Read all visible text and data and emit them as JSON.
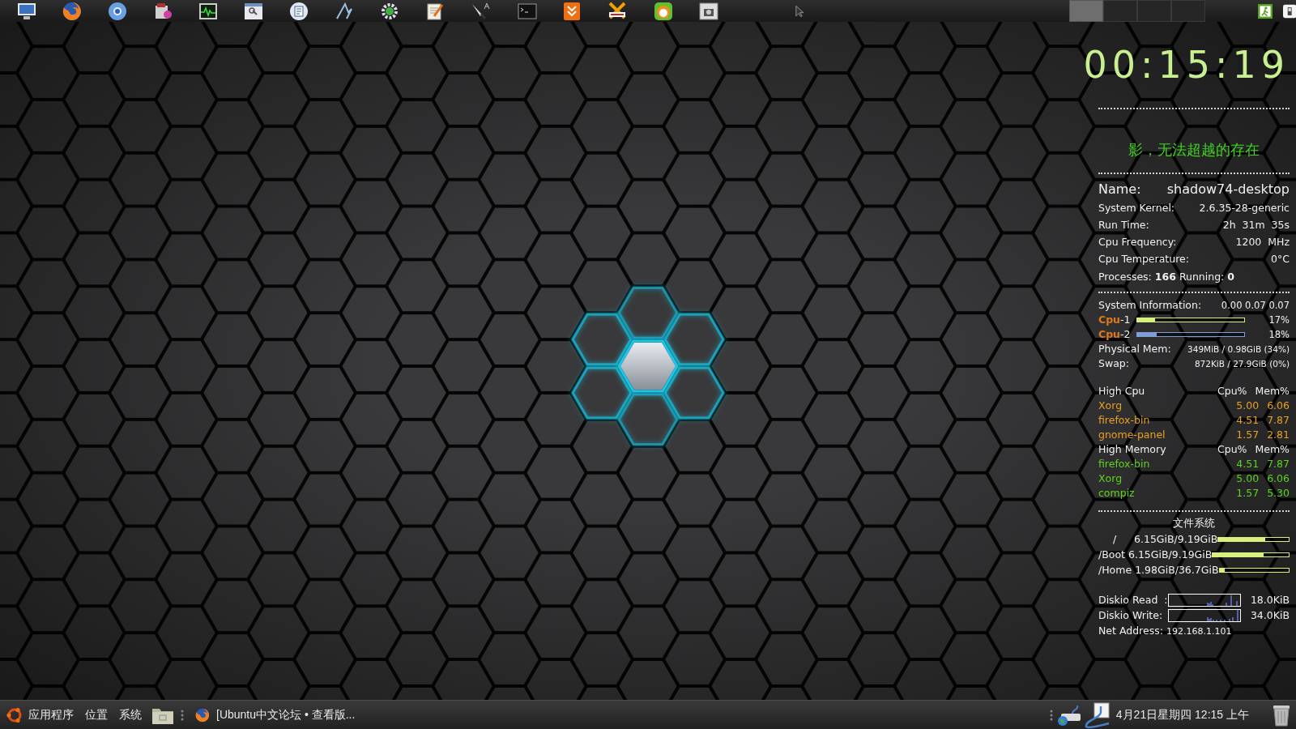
{
  "top_panel": {
    "workspaces": [
      {
        "selected": true
      },
      {
        "selected": false
      },
      {
        "selected": false
      },
      {
        "selected": false
      }
    ]
  },
  "conky": {
    "clock": "00:15:19",
    "motto": "影，无法超越的存在",
    "name": {
      "label": "Name:",
      "value": "shadow74-desktop"
    },
    "info": [
      {
        "label": "System Kernel:",
        "value": "2.6.35-28-generic"
      },
      {
        "label": "Run Time:",
        "value": "2h  31m  35s"
      },
      {
        "label": "Cpu Frequency:",
        "value": "1200  MHz"
      },
      {
        "label": "Cpu Temperature:",
        "value": "0°C"
      }
    ],
    "processes": "Processes: **166** Running: **0**",
    "system_information": {
      "label": "System Information:",
      "value": "0.00 0.07 0.07"
    },
    "cpus": [
      {
        "label": "Cpu",
        "number": "-1",
        "level": 0.17,
        "reading": "17%",
        "color": "#d8f080"
      },
      {
        "label": "Cpu",
        "number": "-2",
        "level": 0.18,
        "reading": "18%",
        "color": "#7f9fd8"
      }
    ],
    "memory": [
      {
        "label": "Physical Mem:",
        "value": "349MiB / 0.98GiB (34%)"
      },
      {
        "label": "Swap:",
        "value": "872KiB / 27.9GiB (0%)"
      }
    ],
    "high_cpu": {
      "title": "High Cpu",
      "columns": [
        "Cpu%",
        "Mem%"
      ],
      "rows": [
        {
          "name": "Xorg",
          "cpu": "5.00",
          "mem": "6.06"
        },
        {
          "name": "firefox-bin",
          "cpu": "4.51",
          "mem": "7.87"
        },
        {
          "name": "gnome-panel",
          "cpu": "1.57",
          "mem": "2.81"
        }
      ]
    },
    "high_memory": {
      "title": "High Memory",
      "columns": [
        "Cpu%",
        "Mem%"
      ],
      "rows": [
        {
          "name": "firefox-bin",
          "cpu": "4.51",
          "mem": "7.87"
        },
        {
          "name": "Xorg",
          "cpu": "5.00",
          "mem": "6.06"
        },
        {
          "name": "compiz",
          "cpu": "1.57",
          "mem": "5.30"
        }
      ]
    },
    "filesystem": {
      "title": "文件系统",
      "mounts": [
        {
          "path": "/",
          "usage": "6.15GiB/9.19GiB",
          "level": 0.67
        },
        {
          "path": "/Boot",
          "usage": "6.15GiB/9.19GiB",
          "level": 0.67
        },
        {
          "path": "/Home",
          "usage": "1.98GiB/36.7GiB",
          "level": 0.08
        }
      ]
    },
    "diskio": [
      {
        "label": "Diskio Read  :",
        "value": "18.0KiB"
      },
      {
        "label": "Diskio Write:",
        "value": "34.0KiB"
      }
    ],
    "net": {
      "label": "Net Address:",
      "value": "192.168.1.101"
    }
  },
  "bottom_panel": {
    "menus": [
      "应用程序",
      "位置",
      "系统"
    ],
    "tasks": [
      {
        "title": "[Ubuntu中文论坛 • 查看版..."
      }
    ],
    "clock": "4月21日星期四 12:15 上午"
  }
}
